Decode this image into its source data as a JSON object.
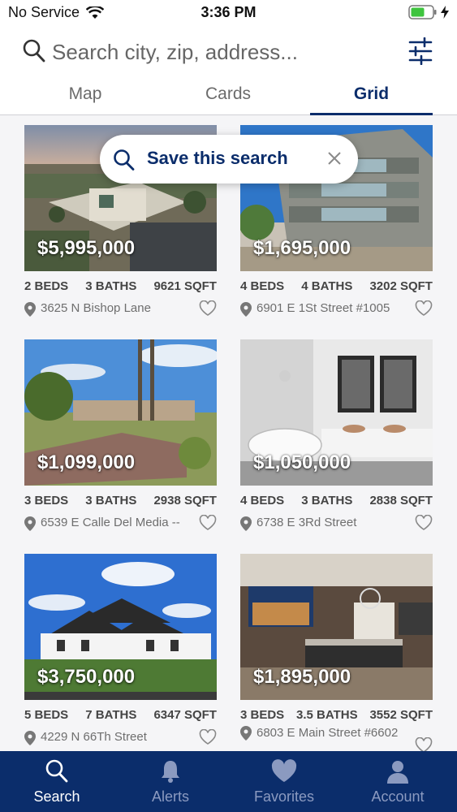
{
  "status": {
    "carrier": "No Service",
    "time": "3:36 PM",
    "battery_color": "#3ec43e"
  },
  "search": {
    "placeholder": "Search city, zip, address..."
  },
  "tabs": [
    {
      "label": "Map",
      "active": false
    },
    {
      "label": "Cards",
      "active": false
    },
    {
      "label": "Grid",
      "active": true
    }
  ],
  "save_search": {
    "label": "Save this search"
  },
  "listings": [
    {
      "price": "$5,995,000",
      "beds": "2 BEDS",
      "baths": "3 BATHS",
      "sqft": "9621 SQFT",
      "address": "3625 N Bishop Lane"
    },
    {
      "price": "$1,695,000",
      "beds": "4 BEDS",
      "baths": "4 BATHS",
      "sqft": "3202 SQFT",
      "address": "6901 E 1St Street #1005"
    },
    {
      "price": "$1,099,000",
      "beds": "3 BEDS",
      "baths": "3 BATHS",
      "sqft": "2938 SQFT",
      "address": "6539 E Calle Del Media --"
    },
    {
      "price": "$1,050,000",
      "beds": "4 BEDS",
      "baths": "3 BATHS",
      "sqft": "2838 SQFT",
      "address": "6738 E 3Rd Street"
    },
    {
      "price": "$3,750,000",
      "beds": "5 BEDS",
      "baths": "7 BATHS",
      "sqft": "6347 SQFT",
      "address": "4229 N 66Th Street"
    },
    {
      "price": "$1,895,000",
      "beds": "3 BEDS",
      "baths": "3.5 BATHS",
      "sqft": "3552 SQFT",
      "address": "6803 E Main Street #6602"
    }
  ],
  "bottom_nav": [
    {
      "label": "Search",
      "icon": "search-icon",
      "active": true
    },
    {
      "label": "Alerts",
      "icon": "bell-icon",
      "active": false
    },
    {
      "label": "Favorites",
      "icon": "heart-icon",
      "active": false
    },
    {
      "label": "Account",
      "icon": "person-icon",
      "active": false
    }
  ],
  "colors": {
    "brand": "#0b2d6b",
    "inactive_nav": "#8b9ac0"
  }
}
